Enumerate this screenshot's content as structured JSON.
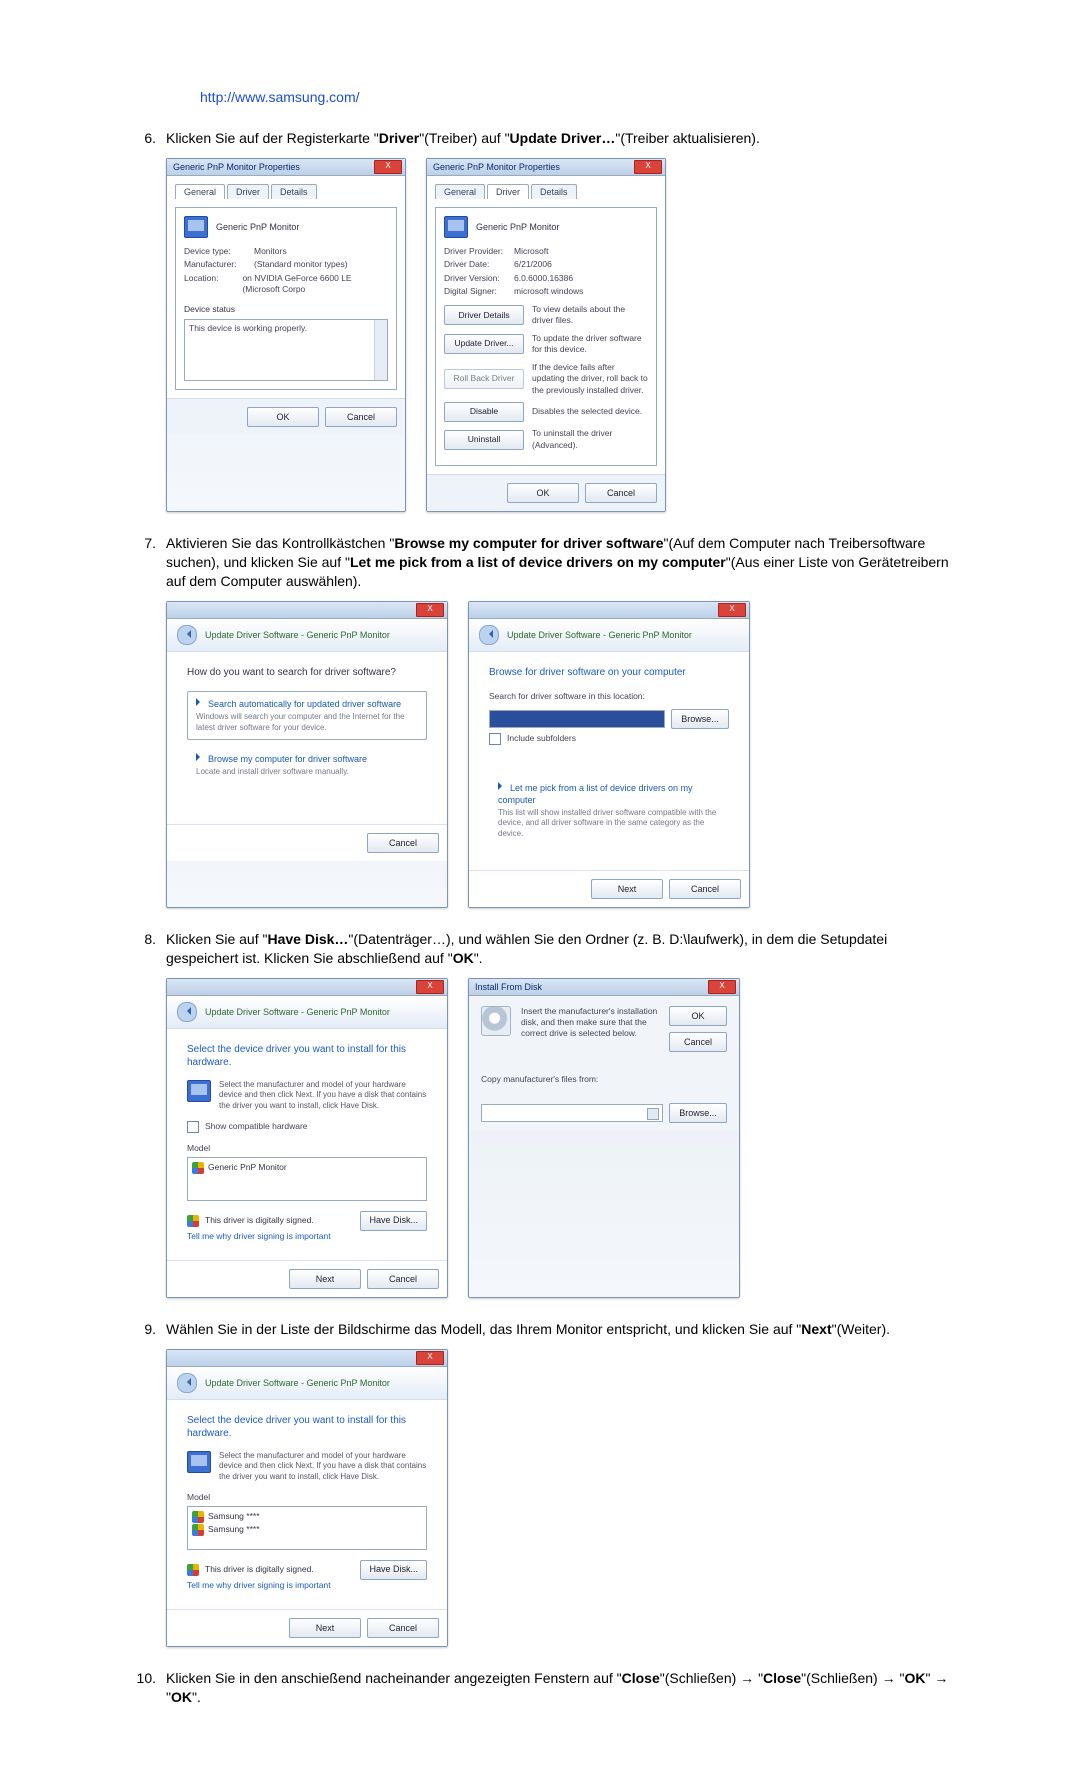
{
  "link": {
    "url": "http://www.samsung.com/"
  },
  "steps": {
    "s6": {
      "num": "6.",
      "pre": "Klicken Sie auf der Registerkarte \"",
      "b1": "Driver",
      "mid1": "\"(Treiber) auf \"",
      "b2": "Update Driver…",
      "post": "\"(Treiber aktualisieren)."
    },
    "s7": {
      "num": "7.",
      "pre": "Aktivieren Sie das Kontrollkästchen \"",
      "b1": "Browse my computer for driver software",
      "mid1": "\"(Auf dem Computer nach Treibersoftware suchen), und klicken Sie auf \"",
      "b2": "Let me pick from a list of device drivers on my computer",
      "post": "\"(Aus einer Liste von Gerätetreibern auf dem Computer auswählen)."
    },
    "s8": {
      "num": "8.",
      "pre": "Klicken Sie auf \"",
      "b1": "Have Disk…",
      "mid1": "\"(Datenträger…), und wählen Sie den Ordner (z. B. D:\\laufwerk), in dem die Setupdatei gespeichert ist. Klicken Sie abschließend auf \"",
      "b2": "OK",
      "post": "\"."
    },
    "s9": {
      "num": "9.",
      "pre": "Wählen Sie in der Liste der Bildschirme das Modell, das Ihrem Monitor entspricht, und klicken Sie auf \"",
      "b1": "Next",
      "post": "\"(Weiter)."
    },
    "s10": {
      "num": "10.",
      "pre": "Klicken Sie in den anschießend nacheinander angezeigten Fenstern auf \"",
      "b1": "Close",
      "mid1": "\"(Schließen)  →  \"",
      "b2": "Close",
      "mid2": "\"(Schließen)  →  \"",
      "b3": "OK",
      "mid3": "\"  →  \"",
      "b4": "OK",
      "post": "\"."
    }
  },
  "dlg": {
    "props_title": "Generic PnP Monitor Properties",
    "tabs": {
      "general": "General",
      "driver": "Driver",
      "details": "Details"
    },
    "monitor_name": "Generic PnP Monitor",
    "general": {
      "k1": "Device type:",
      "v1": "Monitors",
      "k2": "Manufacturer:",
      "v2": "(Standard monitor types)",
      "k3": "Location:",
      "v3": "on NVIDIA GeForce 6600 LE (Microsoft Corpo",
      "status_lbl": "Device status",
      "status_txt": "This device is working properly."
    },
    "driver": {
      "k1": "Driver Provider:",
      "v1": "Microsoft",
      "k2": "Driver Date:",
      "v2": "6/21/2006",
      "k3": "Driver Version:",
      "v3": "6.0.6000.16386",
      "k4": "Digital Signer:",
      "v4": "microsoft windows",
      "b1": "Driver Details",
      "d1": "To view details about the driver files.",
      "b2": "Update Driver...",
      "d2": "To update the driver software for this device.",
      "b3": "Roll Back Driver",
      "d3": "If the device fails after updating the driver, roll back to the previously installed driver.",
      "b4": "Disable",
      "d4": "Disables the selected device.",
      "b5": "Uninstall",
      "d5": "To uninstall the driver (Advanced)."
    },
    "ok": "OK",
    "cancel": "Cancel",
    "close_x": "X"
  },
  "wiz": {
    "title": "Update Driver Software - Generic PnP Monitor",
    "q1": "How do you want to search for driver software?",
    "opt1_t": "Search automatically for updated driver software",
    "opt1_d": "Windows will search your computer and the Internet for the latest driver software for your device.",
    "opt2_t": "Browse my computer for driver software",
    "opt2_d": "Locate and install driver software manually.",
    "q2": "Browse for driver software on your computer",
    "search_lbl": "Search for driver software in this location:",
    "browse": "Browse...",
    "include": "Include subfolders",
    "opt3_t": "Let me pick from a list of device drivers on my computer",
    "opt3_d": "This list will show installed driver software compatible with the device, and all driver software in the same category as the device.",
    "next": "Next",
    "cancel": "Cancel",
    "sel_hdr": "Select the device driver you want to install for this hardware.",
    "sel_desc": "Select the manufacturer and model of your hardware device and then click Next. If you have a disk that contains the driver you want to install, click Have Disk.",
    "compat": "Show compatible hardware",
    "model": "Model",
    "model_item1": "Generic PnP Monitor",
    "model_s1": "Samsung ****",
    "model_s2": "Samsung ****",
    "signed": "This driver is digitally signed.",
    "why": "Tell me why driver signing is important",
    "havedisk": "Have Disk..."
  },
  "install": {
    "title": "Install From Disk",
    "msg": "Insert the manufacturer's installation disk, and then make sure that the correct drive is selected below.",
    "copy": "Copy manufacturer's files from:",
    "ok": "OK",
    "cancel": "Cancel",
    "browse": "Browse..."
  }
}
